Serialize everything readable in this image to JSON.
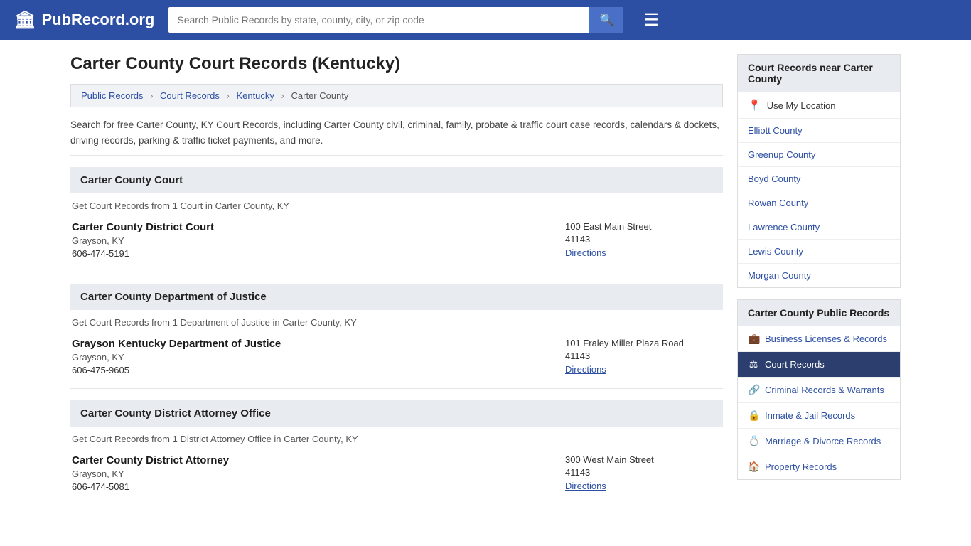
{
  "header": {
    "logo_text": "PubRecord.org",
    "search_placeholder": "Search Public Records by state, county, city, or zip code"
  },
  "page": {
    "title": "Carter County Court Records (Kentucky)",
    "description": "Search for free Carter County, KY Court Records, including Carter County civil, criminal, family, probate & traffic court case records, calendars & dockets, driving records, parking & traffic ticket payments, and more."
  },
  "breadcrumb": {
    "items": [
      "Public Records",
      "Court Records",
      "Kentucky",
      "Carter County"
    ]
  },
  "sections": [
    {
      "id": "court",
      "header": "Carter County Court",
      "desc": "Get Court Records from 1 Court in Carter County, KY",
      "entries": [
        {
          "name": "Carter County District Court",
          "city": "Grayson, KY",
          "phone": "606-474-5191",
          "address": "100 East Main Street",
          "zip": "41143",
          "directions_label": "Directions"
        }
      ]
    },
    {
      "id": "doj",
      "header": "Carter County Department of Justice",
      "desc": "Get Court Records from 1 Department of Justice in Carter County, KY",
      "entries": [
        {
          "name": "Grayson Kentucky Department of Justice",
          "city": "Grayson, KY",
          "phone": "606-475-9605",
          "address": "101 Fraley Miller Plaza Road",
          "zip": "41143",
          "directions_label": "Directions"
        }
      ]
    },
    {
      "id": "da",
      "header": "Carter County District Attorney Office",
      "desc": "Get Court Records from 1 District Attorney Office in Carter County, KY",
      "entries": [
        {
          "name": "Carter County District Attorney",
          "city": "Grayson, KY",
          "phone": "606-474-5081",
          "address": "300 West Main Street",
          "zip": "41143",
          "directions_label": "Directions"
        }
      ]
    }
  ],
  "sidebar": {
    "nearby_title": "Court Records near Carter County",
    "use_location_label": "Use My Location",
    "nearby_counties": [
      "Elliott County",
      "Greenup County",
      "Boyd County",
      "Rowan County",
      "Lawrence County",
      "Lewis County",
      "Morgan County"
    ],
    "public_records_title": "Carter County Public Records",
    "public_records_items": [
      {
        "label": "Business Licenses & Records",
        "icon": "💼",
        "active": false
      },
      {
        "label": "Court Records",
        "icon": "⚖",
        "active": true
      },
      {
        "label": "Criminal Records & Warrants",
        "icon": "🔗",
        "active": false
      },
      {
        "label": "Inmate & Jail Records",
        "icon": "🔒",
        "active": false
      },
      {
        "label": "Marriage & Divorce Records",
        "icon": "💍",
        "active": false
      },
      {
        "label": "Property Records",
        "icon": "🏠",
        "active": false
      }
    ]
  }
}
